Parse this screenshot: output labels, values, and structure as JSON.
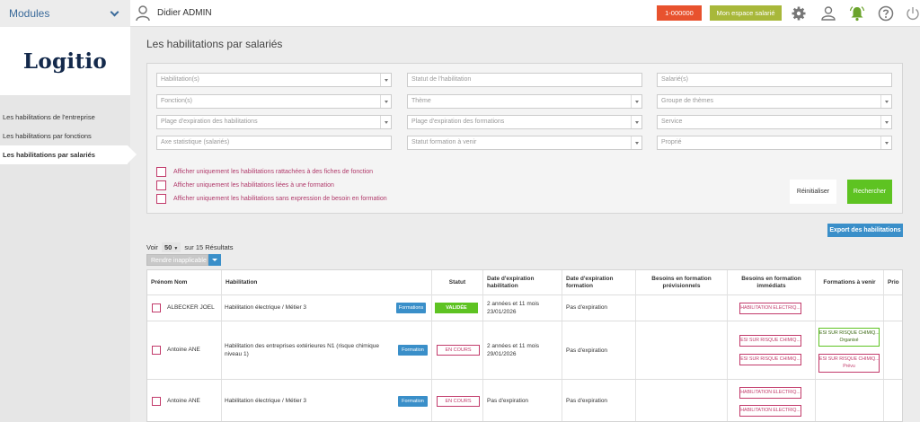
{
  "sidebar": {
    "modules_label": "Modules",
    "logo_text": "Logitio",
    "items": [
      {
        "label": "Les habilitations de l'entreprise"
      },
      {
        "label": "Les habilitations par fonctions"
      },
      {
        "label": "Les habilitations par salariés"
      }
    ]
  },
  "topbar": {
    "user_name": "Didier ADMIN",
    "red_button": "1-000000",
    "olive_button": "Mon espace salarié",
    "icons": [
      "gear-icon",
      "user-icon",
      "bell-icon",
      "help-icon",
      "power-icon"
    ]
  },
  "page": {
    "title": "Les habilitations par salariés"
  },
  "filters": {
    "habilitations": "Habilitation(s)",
    "statut": "Statut de l'habilitation",
    "salaries": "Salarié(s)",
    "fonctions": "Fonction(s)",
    "theme": "Thème",
    "groupe": "Groupe de thèmes",
    "plage_hab": "Plage d'expiration des habilitations",
    "plage_form": "Plage d'expiration des formations",
    "service": "Service",
    "axe": "Axe statistique (salariés)",
    "statut_form": "Statut formation à venir",
    "proprio": "Proprié",
    "check1": "Afficher uniquement les habilitations rattachées à des fiches de fonction",
    "check2": "Afficher uniquement les habilitations liées à une formation",
    "check3": "Afficher uniquement les habilitations sans expression de besoin en formation",
    "reset": "Réinitialiser",
    "search": "Rechercher"
  },
  "list": {
    "export": "Export des habilitations",
    "voir": "Voir",
    "per_page": "50",
    "results": "sur 15 Résultats",
    "rendre": "Rendre inapplicable"
  },
  "table": {
    "headers": {
      "name": "Prénom Nom",
      "habilitation": "Habilitation",
      "statut": "Statut",
      "exp_hab": "Date d'expiration habilitation",
      "exp_form": "Date d'expiration formation",
      "besoins_prev": "Besoins en formation prévisionnels",
      "besoins_imm": "Besoins en formation immédiats",
      "formations": "Formations à venir",
      "prio": "Prio"
    },
    "rows": [
      {
        "name": "ALBECKER JOEL",
        "habilitation": "Habilitation électrique / Métier 3",
        "btn": "Formations",
        "statut": "VALIDÉE",
        "exp_hab_1": "2 années et 11 mois",
        "exp_hab_2": "23/01/2026",
        "exp_form": "Pas d'expiration",
        "besoins_imm": [
          "HABILITATION ELECTRIQ..."
        ]
      },
      {
        "name": "Antoine ANE",
        "habilitation_1": "Habilitation des entreprises extérieures N1 (risque chimique",
        "habilitation_2": "niveau 1)",
        "btn": "Formation",
        "statut": "EN COURS",
        "exp_hab_1": "2 années et 11 mois",
        "exp_hab_2": "29/01/2026",
        "exp_form": "Pas d'expiration",
        "besoins_imm": [
          "ESI SUR RISQUE CHIMIQ...",
          "ESI SUR RISQUE CHIMIQ..."
        ],
        "formations": [
          {
            "title": "ESI SUR RISQUE CHIMIQ...",
            "sub": "Organisé"
          },
          {
            "title": "ESI SUR RISQUE CHIMIQ...",
            "sub": "Prévu"
          }
        ]
      },
      {
        "name": "Antoine ANE",
        "habilitation": "Habilitation électrique / Métier 3",
        "btn": "Formation",
        "statut": "EN COURS",
        "exp_hab": "Pas d'expiration",
        "exp_form": "Pas d'expiration",
        "besoins_imm": [
          "HABILITATION ELECTRIQ...",
          "HABILITATION ELECTRIQ..."
        ]
      }
    ]
  },
  "colors": {
    "accent_blue": "#3a8fc9",
    "red": "#e8522e",
    "olive": "#a8b83a",
    "green": "#5ec322",
    "pink": "#c23b6b"
  }
}
